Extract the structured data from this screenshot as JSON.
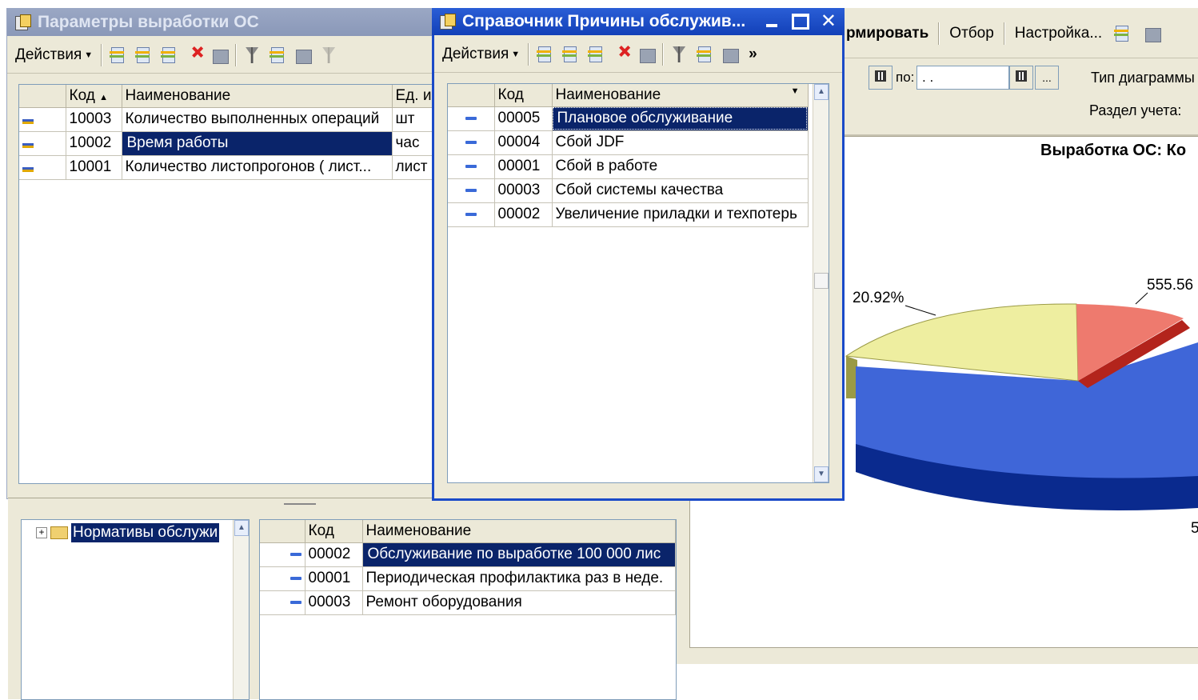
{
  "left_window": {
    "title": "Параметры выработки ОС",
    "actions_label": "Действия",
    "columns": [
      "Код",
      "Наименование",
      "Ед. и"
    ],
    "rows": [
      {
        "code": "10003",
        "name": "Количество выполненных операций",
        "unit": "шт"
      },
      {
        "code": "10002",
        "name": "Время работы",
        "unit": "час"
      },
      {
        "code": "10001",
        "name": "Количество листопрогонов  ( лист...",
        "unit": "лист"
      }
    ]
  },
  "middle_window": {
    "title": "Справочник Причины обслужив...",
    "actions_label": "Действия",
    "more_label": "»",
    "columns": [
      "Код",
      "Наименование"
    ],
    "rows": [
      {
        "code": "00005",
        "name": "Плановое обслуживание"
      },
      {
        "code": "00004",
        "name": "Сбой JDF"
      },
      {
        "code": "00001",
        "name": "Сбой в работе"
      },
      {
        "code": "00003",
        "name": "Сбой системы качества"
      },
      {
        "code": "00002",
        "name": "Увеличение приладки и техпотерь"
      }
    ]
  },
  "right_window": {
    "toolbar": {
      "generate": "рмировать",
      "filter": "Отбор",
      "settings": "Настройка..."
    },
    "to_label": "по:",
    "date_value": ". .",
    "ellipsis": "...",
    "chart_type_label": "Тип диаграммы",
    "section_label": "Раздел учета:",
    "report_title": "Выработка ОС: Ко",
    "chart_labels": {
      "yellow": "20.92%",
      "red": "555.56",
      "blue": "5"
    }
  },
  "chart_data": {
    "type": "pie",
    "title": "Выработка ОС: Ко",
    "series": [
      {
        "label": "20.92%",
        "value": 20.92,
        "color": "#eeeea0"
      },
      {
        "label": "555.56",
        "value": 10,
        "color": "#ee7a6e"
      },
      {
        "label": "5",
        "value": 69.08,
        "color": "#3f66d8"
      }
    ]
  },
  "bottom_window": {
    "tree_label": "Нормативы обслужи",
    "columns": [
      "Код",
      "Наименование"
    ],
    "rows": [
      {
        "code": "00002",
        "name": "Обслуживание по  выработке 100 000 лис"
      },
      {
        "code": "00001",
        "name": "Периодическая профилактика раз в неде."
      },
      {
        "code": "00003",
        "name": "Ремонт оборудования"
      }
    ]
  }
}
